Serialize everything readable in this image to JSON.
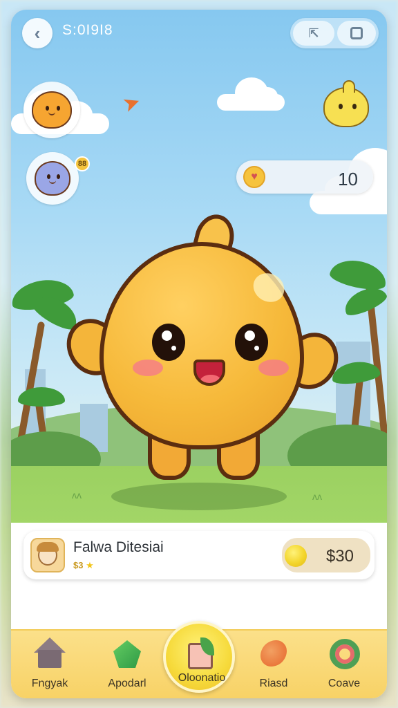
{
  "header": {
    "back_icon": "‹",
    "title": "S:0I9I8",
    "icon_a": "⇱",
    "icon_b": "square-icon"
  },
  "score": {
    "value": "10"
  },
  "friends": [
    {
      "name": "orange-friend"
    },
    {
      "name": "blue-friend",
      "badge": "88"
    }
  ],
  "player": {
    "name": "Falwa Ditesiai",
    "sub": "$3",
    "coins": "$30"
  },
  "nav": {
    "items": [
      {
        "label": "Fngyak",
        "icon": "house-icon"
      },
      {
        "label": "Apodarl",
        "icon": "gem-icon"
      },
      {
        "label": "Oloonatio",
        "icon": "note-icon"
      },
      {
        "label": "Riasd",
        "icon": "fish-icon"
      },
      {
        "label": "Coave",
        "icon": "wreath-icon"
      }
    ]
  },
  "colors": {
    "sky": "#86c8f0",
    "ground": "#a6d86a",
    "pet": "#f6b93a",
    "nav": "#f8d266"
  }
}
